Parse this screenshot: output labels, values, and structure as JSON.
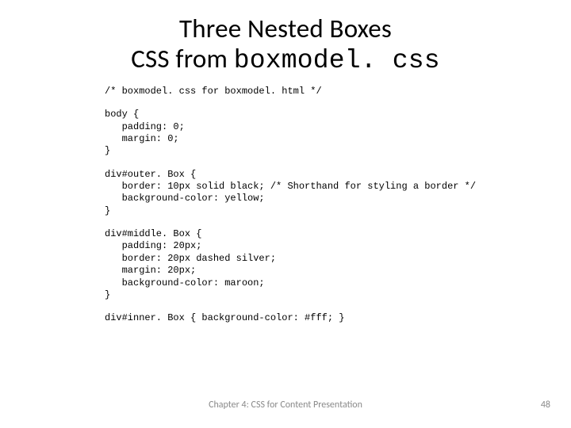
{
  "title": {
    "line1": "Three Nested Boxes",
    "line2_prefix": "CSS from ",
    "line2_mono": "boxmodel. css"
  },
  "code": {
    "comment": "/* boxmodel. css for boxmodel. html */",
    "body": "body {\n   padding: 0;\n   margin: 0;\n}",
    "outer": "div#outer. Box {\n   border: 10px solid black; /* Shorthand for styling a border */\n   background-color: yellow;\n}",
    "middle": "div#middle. Box {\n   padding: 20px;\n   border: 20px dashed silver;\n   margin: 20px;\n   background-color: maroon;\n}",
    "inner": "div#inner. Box { background-color: #fff; }"
  },
  "footer": {
    "chapter": "Chapter 4: CSS for Content Presentation",
    "page": "48"
  }
}
